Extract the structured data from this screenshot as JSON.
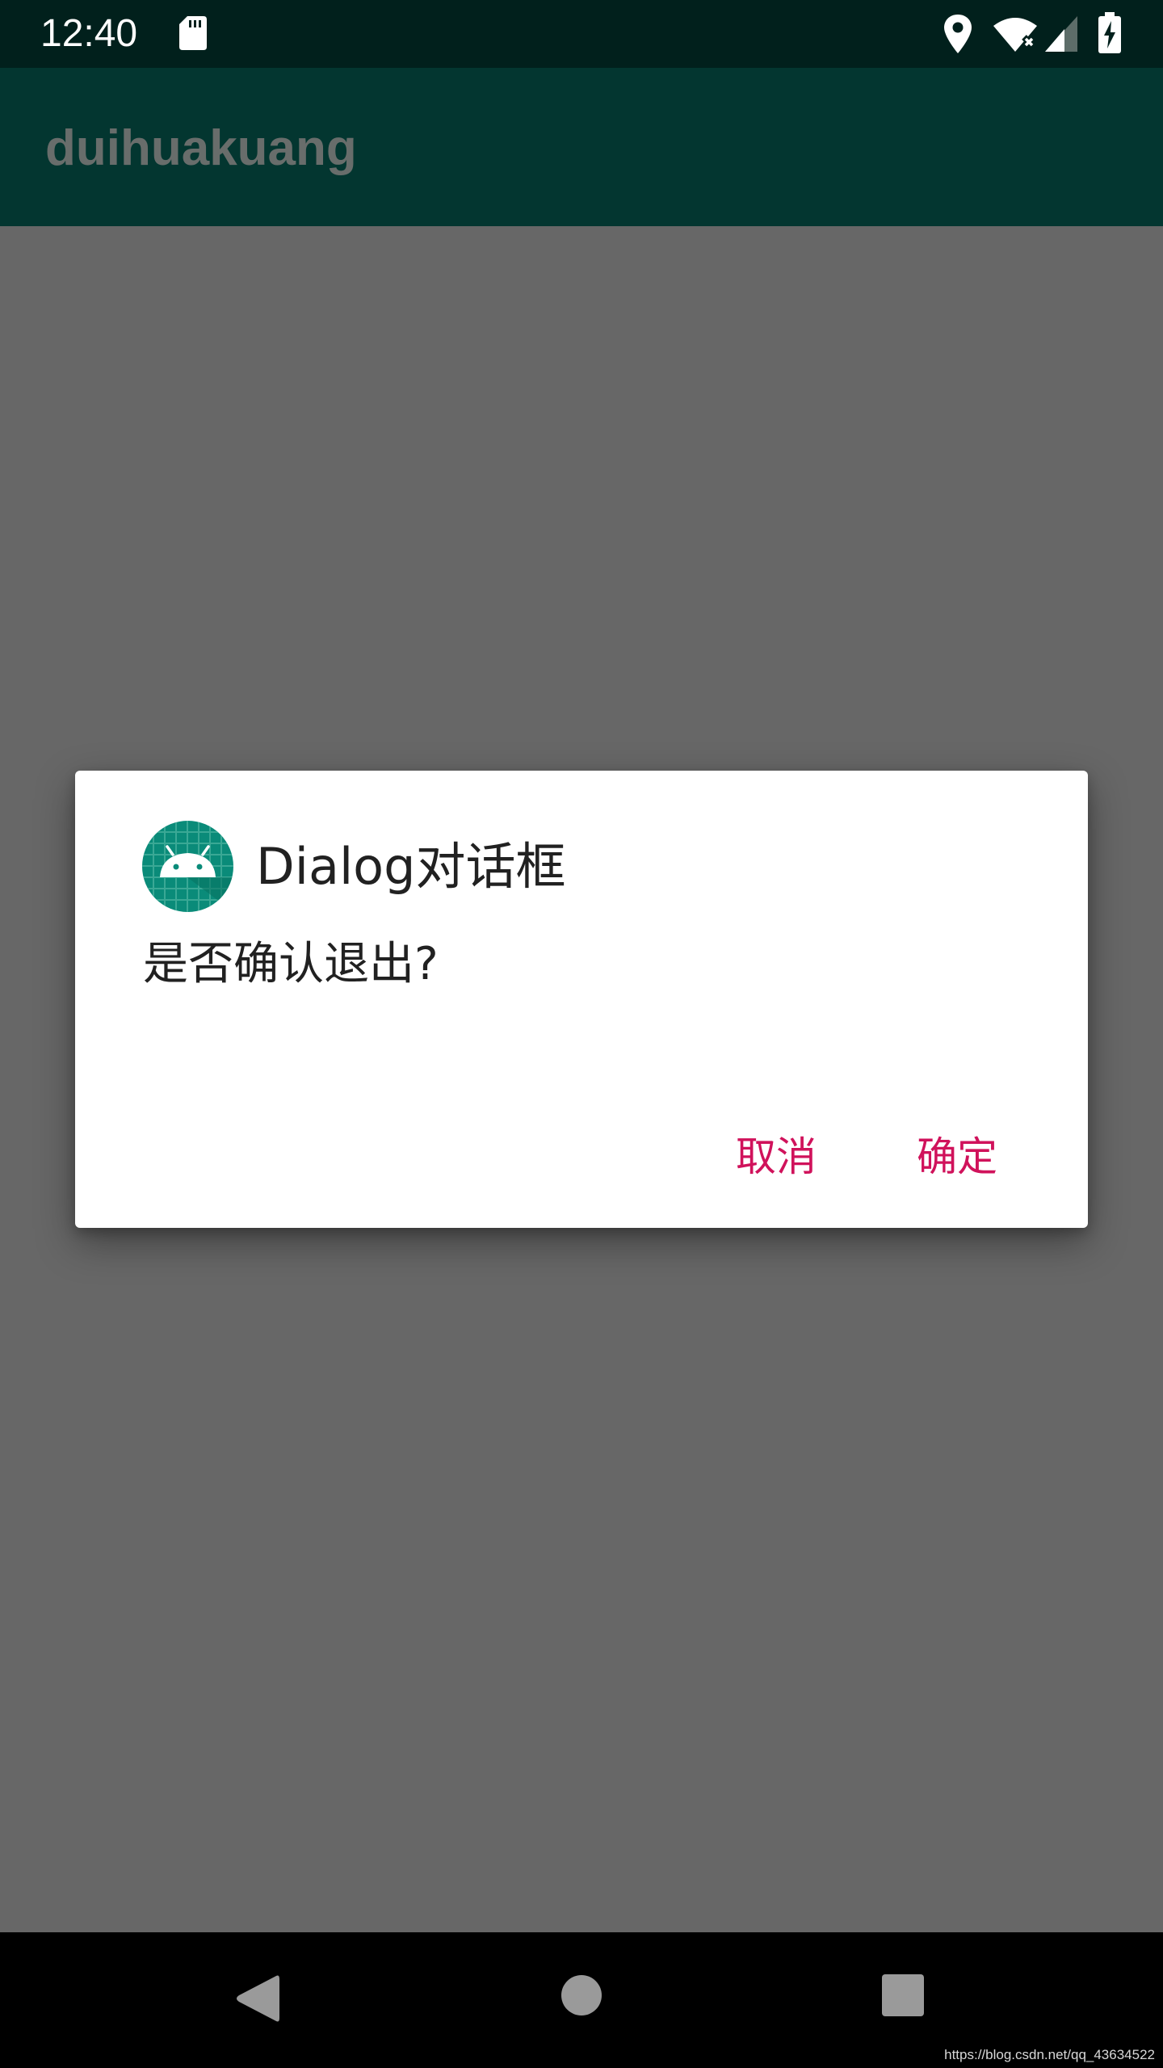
{
  "status_bar": {
    "time": "12:40",
    "icons": [
      "sd-card-icon",
      "location-icon",
      "wifi-icon",
      "cell-signal-icon",
      "battery-charging-icon"
    ]
  },
  "app_bar": {
    "title": "duihuakuang"
  },
  "dialog": {
    "icon": "android-app-icon",
    "title": "Dialog对话框",
    "message": "是否确认退出?",
    "buttons": {
      "cancel": "取消",
      "ok": "确定"
    },
    "button_color": "#d0125b"
  },
  "nav_bar": {
    "icons": [
      "back-icon",
      "home-icon",
      "recents-icon"
    ]
  },
  "watermark": "https://blog.csdn.net/qq_43634522",
  "colors": {
    "status_bar": "#01201c",
    "app_bar": "#033630",
    "scrim": "#676767",
    "icon_teal": "#0a8b79"
  }
}
